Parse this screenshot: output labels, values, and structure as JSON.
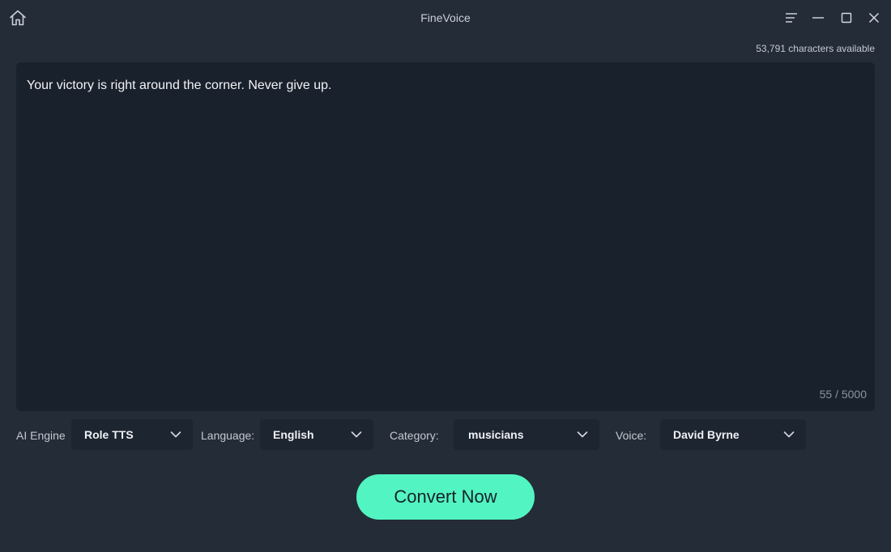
{
  "app": {
    "title": "FineVoice"
  },
  "icons": {
    "home": "home-icon",
    "menu": "menu-icon",
    "minimize": "minimize-icon",
    "maximize": "maximize-icon",
    "close": "close-icon",
    "chevron": "chevron-down-icon"
  },
  "editor": {
    "characters_available": "53,791 characters available",
    "text": "Your victory is right around the corner. Never give up.",
    "char_count": "55 / 5000"
  },
  "controls": {
    "ai_engine": {
      "label": "AI Engine",
      "value": "Role TTS"
    },
    "language": {
      "label": "Language:",
      "value": "English"
    },
    "category": {
      "label": "Category:",
      "value": "musicians"
    },
    "voice": {
      "label": "Voice:",
      "value": "David Byrne"
    }
  },
  "actions": {
    "convert_label": "Convert Now"
  },
  "colors": {
    "background": "#242c37",
    "editor_background": "#19212c",
    "select_background": "#1d2530",
    "accent": "#52f5c1"
  }
}
